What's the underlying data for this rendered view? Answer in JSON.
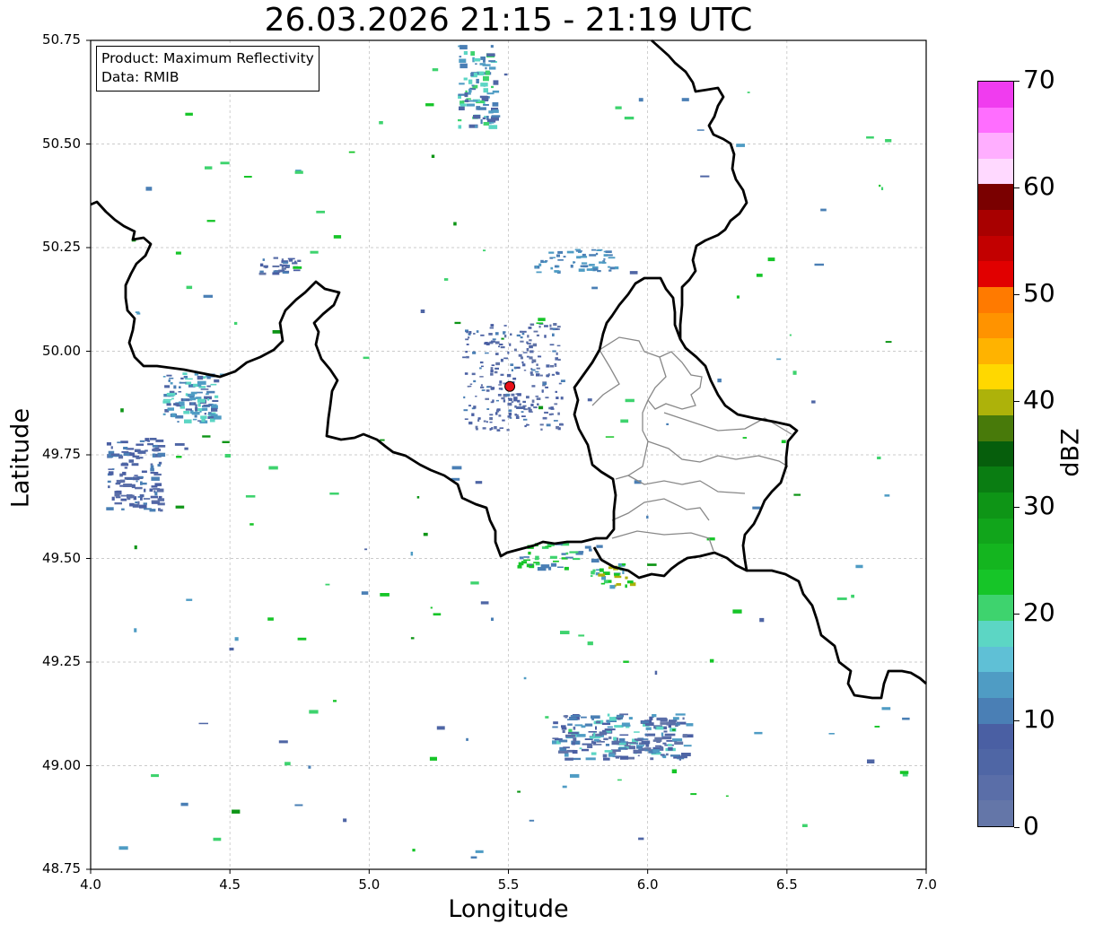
{
  "title": "26.03.2026 21:15 - 21:19 UTC",
  "xlabel": "Longitude",
  "ylabel": "Latitude",
  "info": {
    "product": "Product: Maximum Reflectivity",
    "data": "Data: RMIB"
  },
  "lon_range": [
    4.0,
    7.0
  ],
  "lat_range": [
    48.75,
    50.75
  ],
  "x_ticks": [
    "4.0",
    "4.5",
    "5.0",
    "5.5",
    "6.0",
    "6.5",
    "7.0"
  ],
  "y_ticks": [
    "48.75",
    "49.00",
    "49.25",
    "49.50",
    "49.75",
    "50.00",
    "50.25",
    "50.50",
    "50.75"
  ],
  "colorbar": {
    "label": "dBZ",
    "ticks": [
      "0",
      "10",
      "20",
      "30",
      "40",
      "50",
      "60",
      "70"
    ],
    "range": [
      0,
      70
    ],
    "colors": [
      "#6476a8",
      "#5a6ea8",
      "#4f66a5",
      "#4a5fa3",
      "#4a7fb5",
      "#4f9cc4",
      "#5fc0d6",
      "#5cd6c4",
      "#3ed36e",
      "#16c528",
      "#14b51f",
      "#11a51b",
      "#0e9516",
      "#0a7d12",
      "#065e0c",
      "#487a0a",
      "#adb20a",
      "#ffd800",
      "#ffb300",
      "#ff9300",
      "#ff7a00",
      "#e10000",
      "#c20000",
      "#a80000",
      "#7a0000",
      "#ffd9ff",
      "#ffaeff",
      "#ff6eff",
      "#f03cef"
    ]
  },
  "station": {
    "lon": 5.505,
    "lat": 49.915,
    "color": "#e8101a"
  },
  "grid": true
}
